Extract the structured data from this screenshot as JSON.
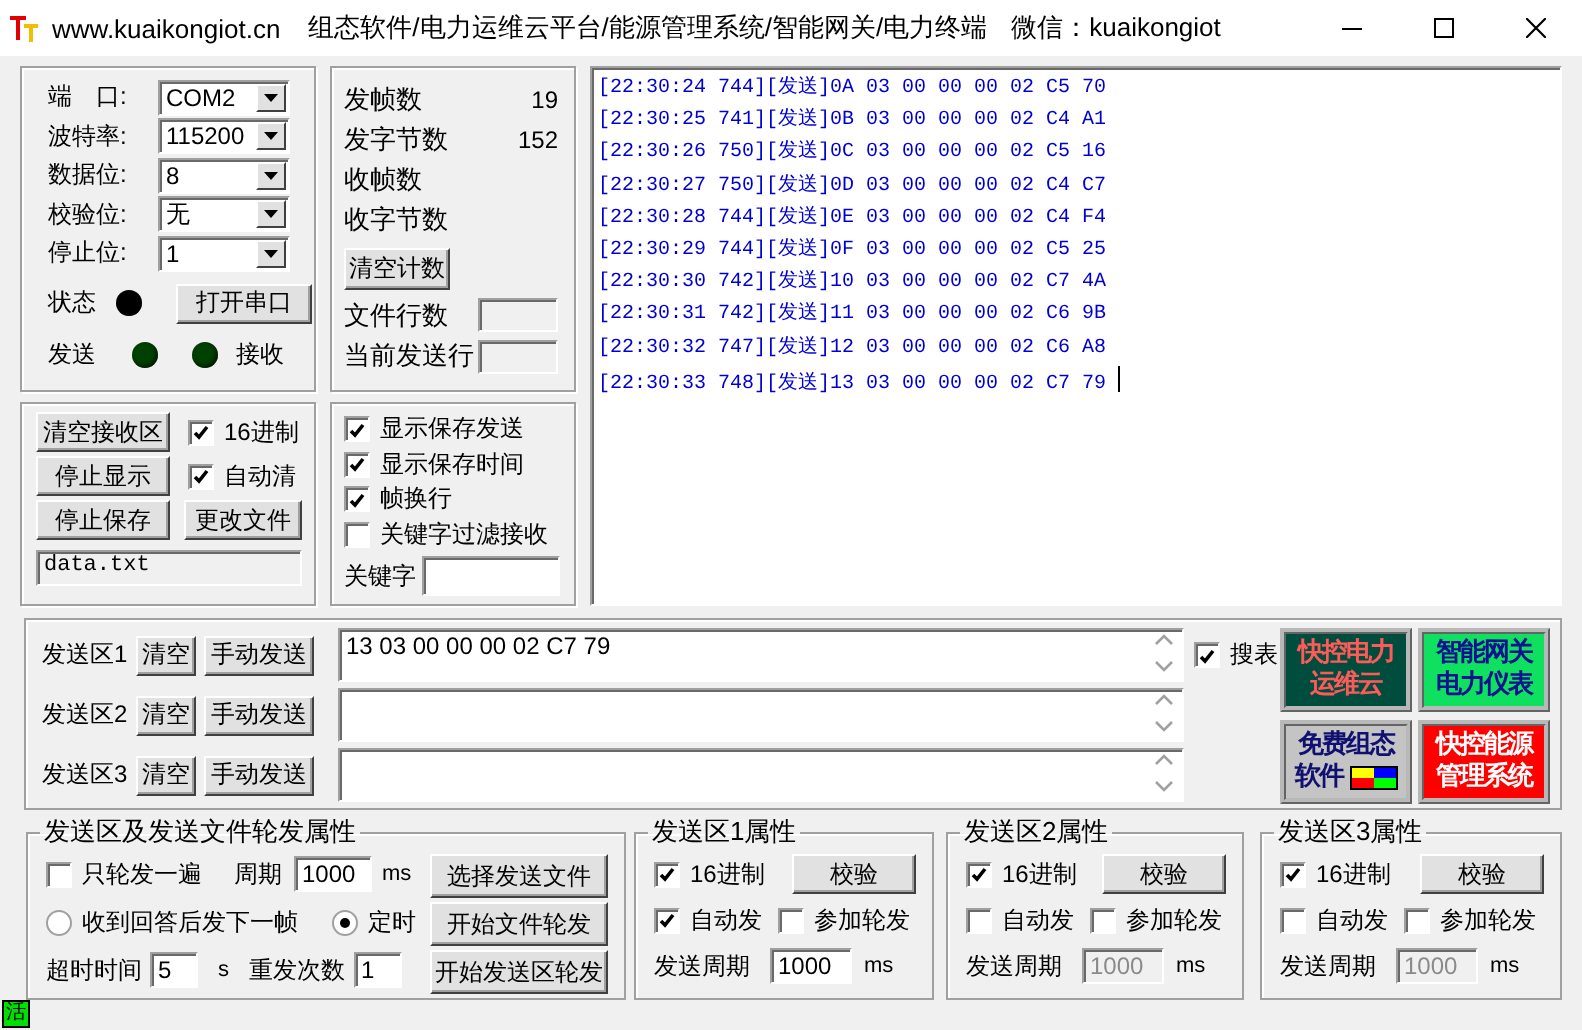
{
  "title_bar": {
    "site": "www.kuaikongiot.cn",
    "links": "组态软件/电力运维云平台/能源管理系统/智能网关/电力终端",
    "wechat": "微信：kuaikongiot"
  },
  "port_panel": {
    "fields": [
      {
        "label": "端　口:",
        "value": "COM2"
      },
      {
        "label": "波特率:",
        "value": "115200"
      },
      {
        "label": "数据位:",
        "value": "8"
      },
      {
        "label": "校验位:",
        "value": "无"
      },
      {
        "label": "停止位:",
        "value": "1"
      }
    ],
    "status_label": "状态",
    "port_open": false,
    "open_button": "打开串口",
    "send_label": "发送",
    "sending": false,
    "receiving": false,
    "receive_label": "接收"
  },
  "counter_panel": {
    "counters": [
      {
        "label": "发帧数",
        "value": "19"
      },
      {
        "label": "发字节数",
        "value": "152"
      },
      {
        "label": "收帧数"
      },
      {
        "label": "收字节数"
      }
    ],
    "clear_button": "清空计数",
    "file_lines_label": "文件行数",
    "current_line_label": "当前发送行"
  },
  "receive_panel": {
    "clear_button": "清空接收区",
    "stop_display_button": "停止显示",
    "stop_save_button": "停止保存",
    "change_file_button": "更改文件",
    "hex": {
      "label": "16进制",
      "checked": true
    },
    "auto_clear": {
      "label": "自动清",
      "checked": true
    },
    "file_name": "data.txt"
  },
  "display_panel": {
    "options": [
      {
        "label": "显示保存发送",
        "checked": true
      },
      {
        "label": "显示保存时间",
        "checked": true
      },
      {
        "label": "帧换行",
        "checked": true
      },
      {
        "label": "关键字过滤接收",
        "checked": false
      }
    ],
    "keyword_label": "关键字"
  },
  "log": {
    "lines": [
      "[22:30:24 744][发送]0A 03 00 00 00 02 C5 70",
      "[22:30:25 741][发送]0B 03 00 00 00 02 C4 A1",
      "[22:30:26 750][发送]0C 03 00 00 00 02 C5 16",
      "[22:30:27 750][发送]0D 03 00 00 00 02 C4 C7",
      "[22:30:28 744][发送]0E 03 00 00 00 02 C4 F4",
      "[22:30:29 744][发送]0F 03 00 00 00 02 C5 25",
      "[22:30:30 742][发送]10 03 00 00 00 02 C7 4A",
      "[22:30:31 742][发送]11 03 00 00 00 02 C6 9B",
      "[22:30:32 747][发送]12 03 00 00 00 02 C6 A8",
      "[22:30:33 748][发送]13 03 00 00 00 02 C7 79"
    ]
  },
  "send_areas": [
    {
      "label": "发送区1",
      "clear_button": "清空",
      "send_button": "手动发送",
      "value": "13 03 00 00 00 02 C7 79"
    },
    {
      "label": "发送区2",
      "clear_button": "清空",
      "send_button": "手动发送"
    },
    {
      "label": "发送区3",
      "clear_button": "清空",
      "send_button": "手动发送"
    }
  ],
  "search_meter": {
    "label": "搜表",
    "checked": true
  },
  "promo_buttons": [
    {
      "kind": "teal",
      "lines": [
        "快控电力",
        "运维云"
      ]
    },
    {
      "kind": "green",
      "lines": [
        "智能网关",
        "电力仪表"
      ]
    },
    {
      "kind": "gray",
      "lines": [
        "免费组态",
        "软件"
      ]
    },
    {
      "kind": "red",
      "lines": [
        "快控能源",
        "管理系统"
      ]
    }
  ],
  "polling": {
    "title": "发送区及发送文件轮发属性",
    "once": {
      "label": "只轮发一遍",
      "checked": false
    },
    "period_label": "周期",
    "period": "1000",
    "period_unit": "ms",
    "modes": [
      {
        "label": "收到回答后发下一帧",
        "selected": false
      },
      {
        "label": "定时",
        "selected": true
      }
    ],
    "timeout_label": "超时时间",
    "timeout": "5",
    "timeout_unit": "s",
    "retry_label": "重发次数",
    "retry": "1",
    "buttons": [
      "选择发送文件",
      "开始文件轮发",
      "开始发送区轮发"
    ]
  },
  "area_settings": [
    {
      "title": "发送区1属性",
      "hex": {
        "label": "16进制",
        "checked": true
      },
      "verify_button": "校验",
      "auto_send": {
        "label": "自动发",
        "checked": true
      },
      "join_polling": {
        "label": "参加轮发",
        "checked": false
      },
      "period_label": "发送周期",
      "period": "1000",
      "period_disabled": false,
      "period_unit": "ms"
    },
    {
      "title": "发送区2属性",
      "hex": {
        "label": "16进制",
        "checked": true
      },
      "verify_button": "校验",
      "auto_send": {
        "label": "自动发",
        "checked": false
      },
      "join_polling": {
        "label": "参加轮发",
        "checked": false
      },
      "period_label": "发送周期",
      "period": "1000",
      "period_disabled": true,
      "period_unit": "ms"
    },
    {
      "title": "发送区3属性",
      "hex": {
        "label": "16进制",
        "checked": true
      },
      "verify_button": "校验",
      "auto_send": {
        "label": "自动发",
        "checked": false
      },
      "join_polling": {
        "label": "参加轮发",
        "checked": false
      },
      "period_label": "发送周期",
      "period": "1000",
      "period_disabled": true,
      "period_unit": "ms"
    }
  ],
  "status_bar": {
    "badge": "活"
  }
}
